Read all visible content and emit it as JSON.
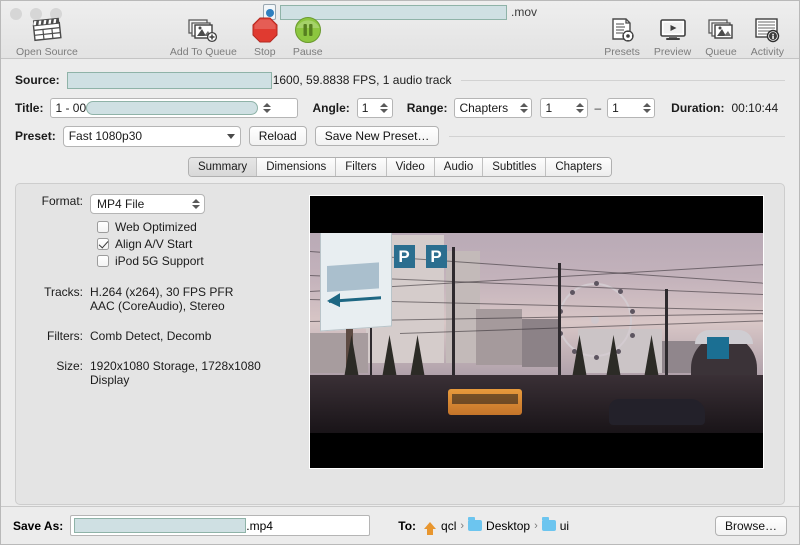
{
  "window": {
    "title_suffix": ".mov",
    "doc_icon": "document-icon"
  },
  "toolbar": {
    "items": [
      {
        "label": "Open Source",
        "icon": "clapperboard-icon"
      },
      {
        "label": "Add To Queue",
        "icon": "add-to-queue-icon"
      },
      {
        "label": "Stop",
        "icon": "stop-octagon-icon"
      },
      {
        "label": "Pause",
        "icon": "pause-circle-icon"
      },
      {
        "label": "Presets",
        "icon": "presets-icon"
      },
      {
        "label": "Preview",
        "icon": "preview-monitor-icon"
      },
      {
        "label": "Queue",
        "icon": "queue-stack-icon"
      },
      {
        "label": "Activity",
        "icon": "activity-log-icon"
      }
    ]
  },
  "source": {
    "label": "Source:",
    "info": "1600, 59.8838 FPS, 1 audio track"
  },
  "title_row": {
    "label": "Title:",
    "value": "1 - 00",
    "angle_label": "Angle:",
    "angle_value": "1",
    "range_label": "Range:",
    "range_value": "Chapters",
    "range_start": "1",
    "range_dash": "–",
    "range_end": "1",
    "duration_label": "Duration:",
    "duration_value": "00:10:44"
  },
  "preset_row": {
    "label": "Preset:",
    "value": "Fast 1080p30",
    "reload_label": "Reload",
    "save_label": "Save New Preset…"
  },
  "tabs": [
    {
      "label": "Summary",
      "active": true
    },
    {
      "label": "Dimensions",
      "active": false
    },
    {
      "label": "Filters",
      "active": false
    },
    {
      "label": "Video",
      "active": false
    },
    {
      "label": "Audio",
      "active": false
    },
    {
      "label": "Subtitles",
      "active": false
    },
    {
      "label": "Chapters",
      "active": false
    }
  ],
  "summary": {
    "format_label": "Format:",
    "format_value": "MP4 File",
    "checkboxes": [
      {
        "label": "Web Optimized",
        "checked": false
      },
      {
        "label": "Align A/V Start",
        "checked": true
      },
      {
        "label": "iPod 5G Support",
        "checked": false
      }
    ],
    "tracks_label": "Tracks:",
    "tracks_line1": "H.264 (x264), 30 FPS PFR",
    "tracks_line2": "AAC (CoreAudio), Stereo",
    "filters_label": "Filters:",
    "filters_value": "Comb Detect, Decomb",
    "size_label": "Size:",
    "size_value": "1920x1080 Storage, 1728x1080 Display"
  },
  "preview": {
    "sign_p1": "P",
    "sign_p2": "P",
    "description": "city-street-dusk-ferris-wheel"
  },
  "bottom": {
    "saveas_label": "Save As:",
    "saveas_suffix": ".mp4",
    "to_label": "To:",
    "path": [
      {
        "name": "qcl",
        "icon": "home-icon"
      },
      {
        "name": "Desktop",
        "icon": "folder-icon"
      },
      {
        "name": "ui",
        "icon": "folder-icon"
      }
    ],
    "sep": "›",
    "browse_label": "Browse…"
  },
  "colors": {
    "redaction": "#cfe0e3",
    "stop_red": "#e03a30",
    "pause_green": "#8cc63f",
    "folder_blue": "#6cc5ef",
    "sign_blue": "#2b6e8f"
  }
}
